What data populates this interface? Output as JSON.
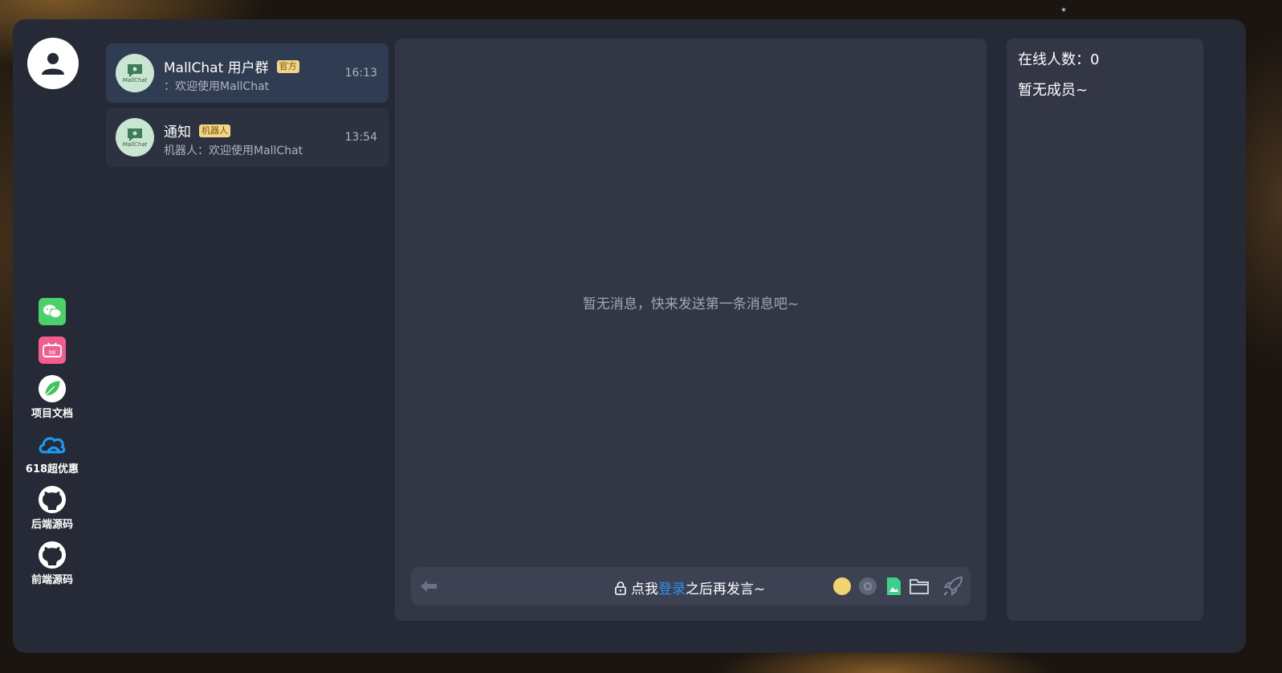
{
  "sidebar": {
    "links": [
      {
        "icon": "wechat-icon",
        "label": ""
      },
      {
        "icon": "bilibili-icon",
        "label": ""
      },
      {
        "icon": "docs-leaf-icon",
        "label": "项目文档"
      },
      {
        "icon": "cloud-icon",
        "label": "618超优惠"
      },
      {
        "icon": "github-icon",
        "label": "后端源码"
      },
      {
        "icon": "github-icon",
        "label": "前端源码"
      }
    ]
  },
  "sessions": [
    {
      "name": "MallChat 用户群",
      "tag": "官方",
      "last_message": "：欢迎使用MallChat",
      "time": "16:13",
      "logo_text": "MallChat"
    },
    {
      "name": "通知",
      "tag": "机器人",
      "last_message": "机器人：欢迎使用MallChat",
      "time": "13:54",
      "logo_text": "MallChat"
    }
  ],
  "chat": {
    "empty_text": "暂无消息，快来发送第一条消息吧~",
    "composer": {
      "prefix": "点我",
      "login_link": "登录",
      "suffix": "之后再发言~"
    }
  },
  "members": {
    "online_label": "在线人数：0",
    "empty_text": "暂无成员~"
  },
  "colors": {
    "app_bg": "#262a37",
    "panel_bg": "#323645",
    "accent": "#2f8df0",
    "tag_bg": "#f3d58a"
  }
}
